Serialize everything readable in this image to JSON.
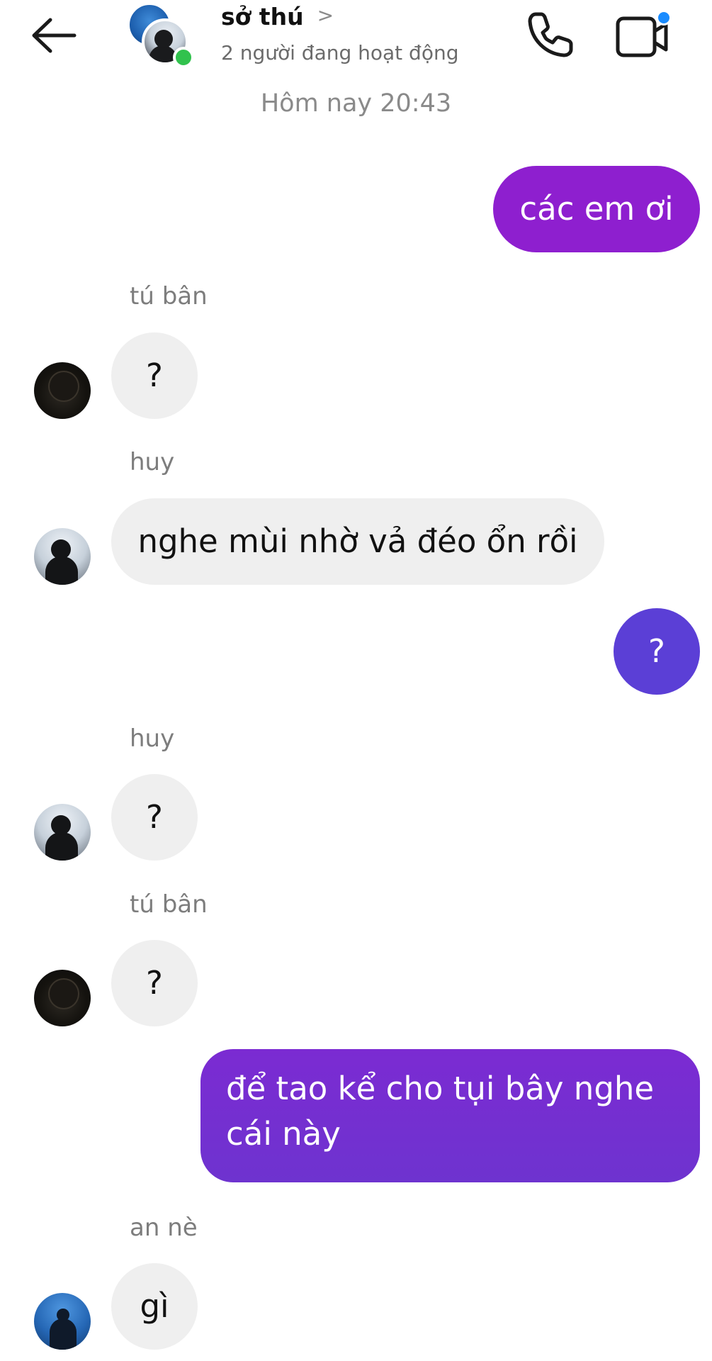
{
  "header": {
    "title": "sở thú",
    "title_chevron": ">",
    "subtitle": "2 người đang hoạt động",
    "icons": {
      "back": "arrow-left-icon",
      "call": "phone-icon",
      "video": "video-camera-icon"
    },
    "accent_colors": {
      "online_dot": "#31c24d",
      "notification_dot": "#1a8cff"
    }
  },
  "timestamp": "Hôm nay 20:43",
  "messages": [
    {
      "direction": "outgoing",
      "text": "các em ơi",
      "color": "#8e1fcf"
    },
    {
      "direction": "incoming",
      "sender": "tú bân",
      "text": "?"
    },
    {
      "direction": "incoming",
      "sender": "huy",
      "text": "nghe mùi nhờ vả đéo ổn rồi"
    },
    {
      "direction": "outgoing",
      "text": "?",
      "color": "#5b3fd6"
    },
    {
      "direction": "incoming",
      "sender": "huy",
      "text": "?"
    },
    {
      "direction": "incoming",
      "sender": "tú bân",
      "text": "?"
    },
    {
      "direction": "outgoing",
      "text_lines": [
        "để tao kể cho tụi bây nghe",
        "cái này"
      ],
      "color": "#7a2fd0"
    },
    {
      "direction": "incoming",
      "sender": "an nè",
      "text": "gì"
    }
  ]
}
